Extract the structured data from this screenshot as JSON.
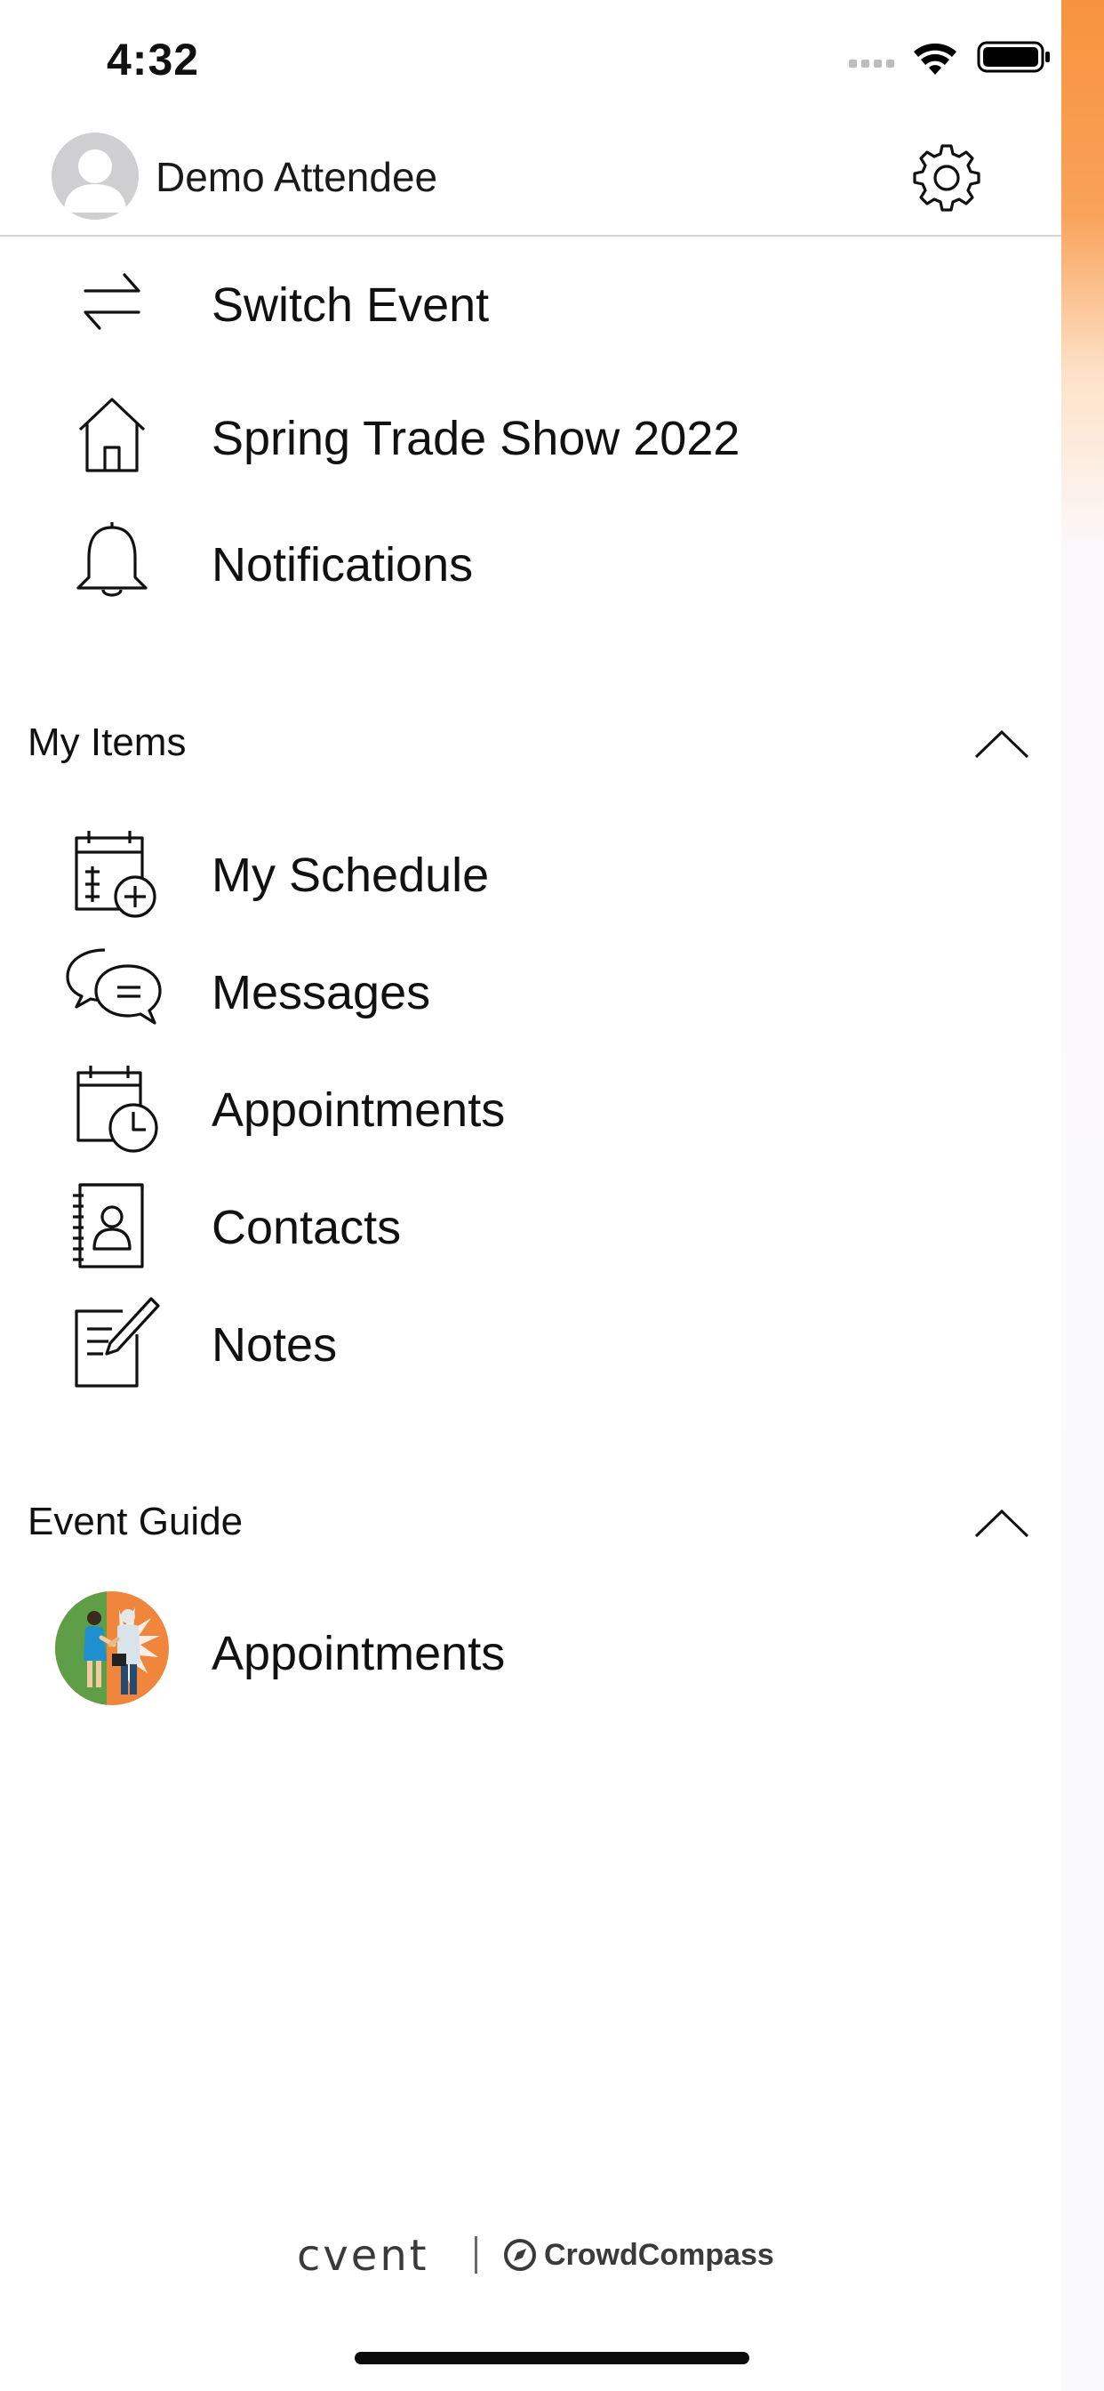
{
  "status_bar": {
    "time": "4:32"
  },
  "profile": {
    "name": "Demo Attendee"
  },
  "top_menu": [
    {
      "label": "Switch Event",
      "icon": "switch-arrows-icon"
    },
    {
      "label": "Spring Trade Show 2022",
      "icon": "home-icon"
    },
    {
      "label": "Notifications",
      "icon": "bell-icon"
    }
  ],
  "my_items": {
    "title": "My Items",
    "items": [
      {
        "label": "My Schedule",
        "icon": "calendar-add-icon"
      },
      {
        "label": "Messages",
        "icon": "chat-bubbles-icon"
      },
      {
        "label": "Appointments",
        "icon": "calendar-clock-icon"
      },
      {
        "label": "Contacts",
        "icon": "address-book-icon"
      },
      {
        "label": "Notes",
        "icon": "note-pencil-icon"
      }
    ]
  },
  "event_guide": {
    "title": "Event Guide",
    "items": [
      {
        "label": "Appointments",
        "icon": "appointments-illustration-icon"
      }
    ]
  },
  "footer": {
    "brand_primary": "cvent",
    "brand_secondary": "CrowdCompass"
  },
  "colors": {
    "accent_orange": "#f7933e",
    "divider": "#d4d4d6",
    "text": "#111111"
  }
}
